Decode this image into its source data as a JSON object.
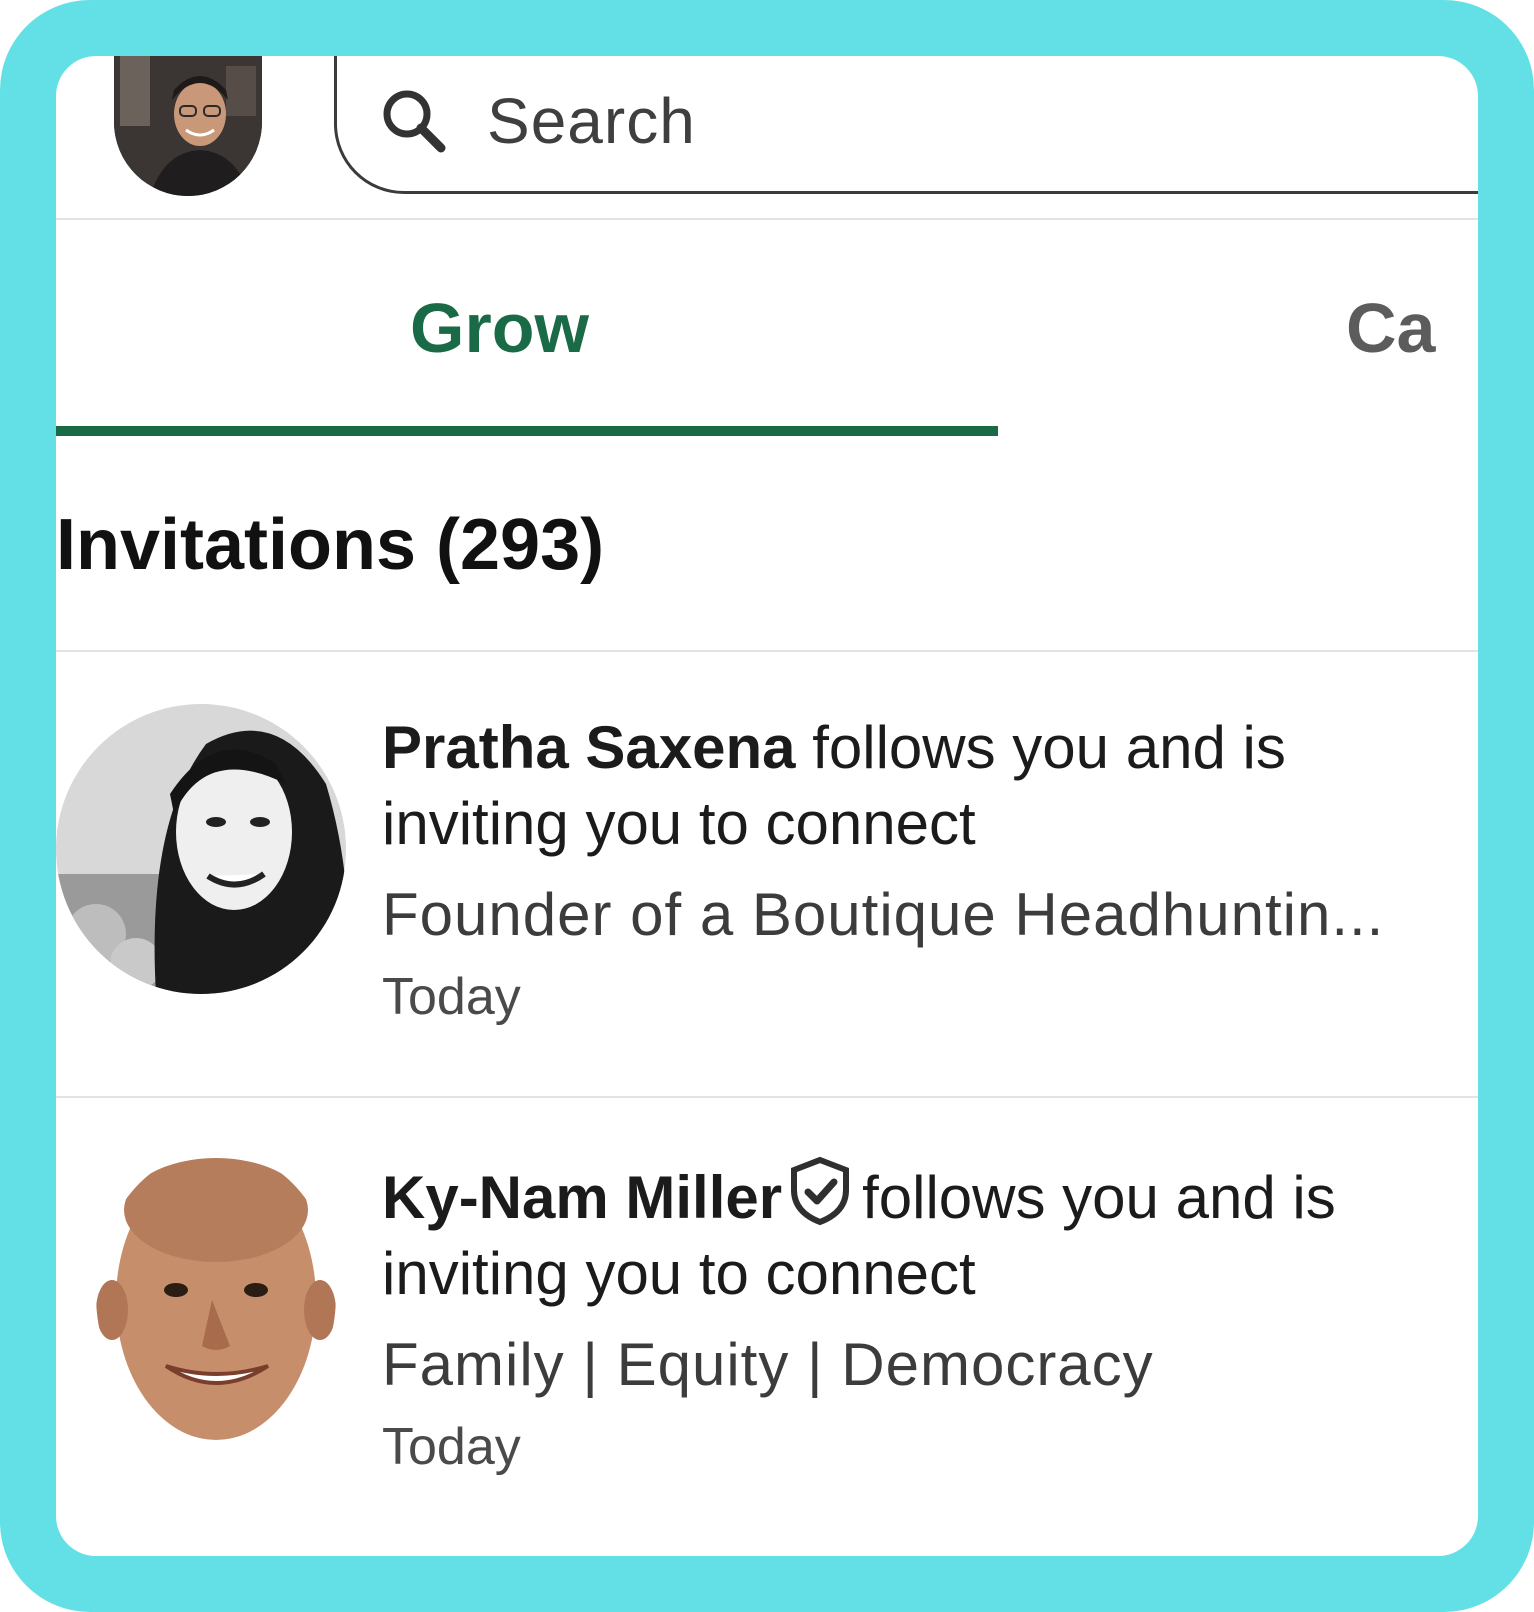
{
  "header": {
    "search_placeholder": "Search",
    "search_icon": "search-icon"
  },
  "tabs": [
    {
      "label": "Grow",
      "active": true
    },
    {
      "label": "Ca",
      "active": false
    }
  ],
  "colors": {
    "frame": "#62e0e6",
    "accent": "#1a6a47"
  },
  "section": {
    "title": "Invitations (293)"
  },
  "invitations": [
    {
      "name": "Pratha Saxena",
      "verified": false,
      "message_line1": " follows you and is",
      "message_line2": "inviting you to connect",
      "subtitle": "Founder of a Boutique Headhuntin...",
      "time": "Today"
    },
    {
      "name": "Ky-Nam Miller",
      "verified": true,
      "message_line1": "follows you and is",
      "message_line2": "inviting you to connect",
      "subtitle": "Family | Equity | Democracy",
      "time": "Today"
    }
  ]
}
